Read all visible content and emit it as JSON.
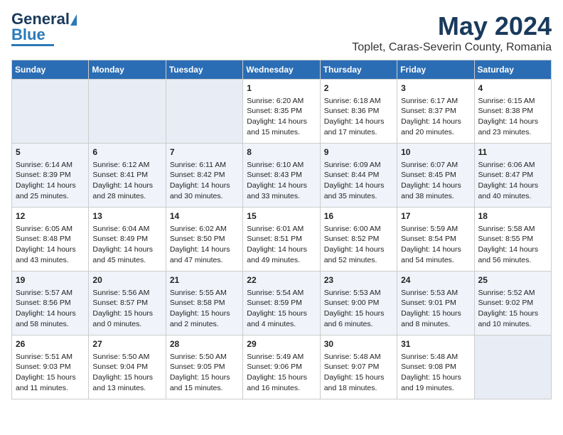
{
  "logo": {
    "line1": "General",
    "line2": "Blue"
  },
  "title": "May 2024",
  "subtitle": "Toplet, Caras-Severin County, Romania",
  "days_header": [
    "Sunday",
    "Monday",
    "Tuesday",
    "Wednesday",
    "Thursday",
    "Friday",
    "Saturday"
  ],
  "weeks": [
    [
      {
        "day": "",
        "info": ""
      },
      {
        "day": "",
        "info": ""
      },
      {
        "day": "",
        "info": ""
      },
      {
        "day": "1",
        "info": "Sunrise: 6:20 AM\nSunset: 8:35 PM\nDaylight: 14 hours\nand 15 minutes."
      },
      {
        "day": "2",
        "info": "Sunrise: 6:18 AM\nSunset: 8:36 PM\nDaylight: 14 hours\nand 17 minutes."
      },
      {
        "day": "3",
        "info": "Sunrise: 6:17 AM\nSunset: 8:37 PM\nDaylight: 14 hours\nand 20 minutes."
      },
      {
        "day": "4",
        "info": "Sunrise: 6:15 AM\nSunset: 8:38 PM\nDaylight: 14 hours\nand 23 minutes."
      }
    ],
    [
      {
        "day": "5",
        "info": "Sunrise: 6:14 AM\nSunset: 8:39 PM\nDaylight: 14 hours\nand 25 minutes."
      },
      {
        "day": "6",
        "info": "Sunrise: 6:12 AM\nSunset: 8:41 PM\nDaylight: 14 hours\nand 28 minutes."
      },
      {
        "day": "7",
        "info": "Sunrise: 6:11 AM\nSunset: 8:42 PM\nDaylight: 14 hours\nand 30 minutes."
      },
      {
        "day": "8",
        "info": "Sunrise: 6:10 AM\nSunset: 8:43 PM\nDaylight: 14 hours\nand 33 minutes."
      },
      {
        "day": "9",
        "info": "Sunrise: 6:09 AM\nSunset: 8:44 PM\nDaylight: 14 hours\nand 35 minutes."
      },
      {
        "day": "10",
        "info": "Sunrise: 6:07 AM\nSunset: 8:45 PM\nDaylight: 14 hours\nand 38 minutes."
      },
      {
        "day": "11",
        "info": "Sunrise: 6:06 AM\nSunset: 8:47 PM\nDaylight: 14 hours\nand 40 minutes."
      }
    ],
    [
      {
        "day": "12",
        "info": "Sunrise: 6:05 AM\nSunset: 8:48 PM\nDaylight: 14 hours\nand 43 minutes."
      },
      {
        "day": "13",
        "info": "Sunrise: 6:04 AM\nSunset: 8:49 PM\nDaylight: 14 hours\nand 45 minutes."
      },
      {
        "day": "14",
        "info": "Sunrise: 6:02 AM\nSunset: 8:50 PM\nDaylight: 14 hours\nand 47 minutes."
      },
      {
        "day": "15",
        "info": "Sunrise: 6:01 AM\nSunset: 8:51 PM\nDaylight: 14 hours\nand 49 minutes."
      },
      {
        "day": "16",
        "info": "Sunrise: 6:00 AM\nSunset: 8:52 PM\nDaylight: 14 hours\nand 52 minutes."
      },
      {
        "day": "17",
        "info": "Sunrise: 5:59 AM\nSunset: 8:54 PM\nDaylight: 14 hours\nand 54 minutes."
      },
      {
        "day": "18",
        "info": "Sunrise: 5:58 AM\nSunset: 8:55 PM\nDaylight: 14 hours\nand 56 minutes."
      }
    ],
    [
      {
        "day": "19",
        "info": "Sunrise: 5:57 AM\nSunset: 8:56 PM\nDaylight: 14 hours\nand 58 minutes."
      },
      {
        "day": "20",
        "info": "Sunrise: 5:56 AM\nSunset: 8:57 PM\nDaylight: 15 hours\nand 0 minutes."
      },
      {
        "day": "21",
        "info": "Sunrise: 5:55 AM\nSunset: 8:58 PM\nDaylight: 15 hours\nand 2 minutes."
      },
      {
        "day": "22",
        "info": "Sunrise: 5:54 AM\nSunset: 8:59 PM\nDaylight: 15 hours\nand 4 minutes."
      },
      {
        "day": "23",
        "info": "Sunrise: 5:53 AM\nSunset: 9:00 PM\nDaylight: 15 hours\nand 6 minutes."
      },
      {
        "day": "24",
        "info": "Sunrise: 5:53 AM\nSunset: 9:01 PM\nDaylight: 15 hours\nand 8 minutes."
      },
      {
        "day": "25",
        "info": "Sunrise: 5:52 AM\nSunset: 9:02 PM\nDaylight: 15 hours\nand 10 minutes."
      }
    ],
    [
      {
        "day": "26",
        "info": "Sunrise: 5:51 AM\nSunset: 9:03 PM\nDaylight: 15 hours\nand 11 minutes."
      },
      {
        "day": "27",
        "info": "Sunrise: 5:50 AM\nSunset: 9:04 PM\nDaylight: 15 hours\nand 13 minutes."
      },
      {
        "day": "28",
        "info": "Sunrise: 5:50 AM\nSunset: 9:05 PM\nDaylight: 15 hours\nand 15 minutes."
      },
      {
        "day": "29",
        "info": "Sunrise: 5:49 AM\nSunset: 9:06 PM\nDaylight: 15 hours\nand 16 minutes."
      },
      {
        "day": "30",
        "info": "Sunrise: 5:48 AM\nSunset: 9:07 PM\nDaylight: 15 hours\nand 18 minutes."
      },
      {
        "day": "31",
        "info": "Sunrise: 5:48 AM\nSunset: 9:08 PM\nDaylight: 15 hours\nand 19 minutes."
      },
      {
        "day": "",
        "info": ""
      }
    ]
  ]
}
